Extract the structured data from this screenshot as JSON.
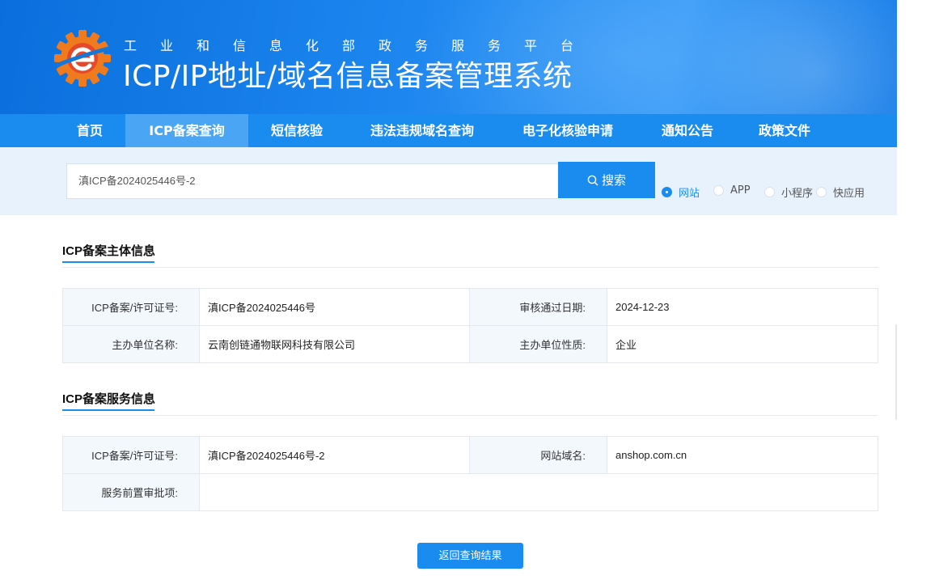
{
  "header": {
    "subtitle": "工业和信息化部政务服务平台",
    "title": "ICP/IP地址/域名信息备案管理系统",
    "logo_icon": "e-gear-logo-icon"
  },
  "nav": {
    "items": [
      {
        "label": "首页",
        "active": false
      },
      {
        "label": "ICP备案查询",
        "active": true
      },
      {
        "label": "短信核验",
        "active": false
      },
      {
        "label": "违法违规域名查询",
        "active": false
      },
      {
        "label": "电子化核验申请",
        "active": false
      },
      {
        "label": "通知公告",
        "active": false
      },
      {
        "label": "政策文件",
        "active": false
      }
    ]
  },
  "search": {
    "value": "滇ICP备2024025446号-2",
    "button_label": "搜索",
    "button_icon": "search-icon",
    "options": [
      {
        "label": "网站",
        "checked": true
      },
      {
        "label": "APP",
        "checked": false
      },
      {
        "label": "小程序",
        "checked": false
      },
      {
        "label": "快应用",
        "checked": false
      }
    ]
  },
  "subject_section": {
    "title": "ICP备案主体信息",
    "rows": [
      {
        "k1": "ICP备案/许可证号:",
        "v1": "滇ICP备2024025446号",
        "k2": "审核通过日期:",
        "v2": "2024-12-23"
      },
      {
        "k1": "主办单位名称:",
        "v1": "云南创链通物联网科技有限公司",
        "k2": "主办单位性质:",
        "v2": "企业"
      }
    ]
  },
  "service_section": {
    "title": "ICP备案服务信息",
    "rows": [
      {
        "k1": "ICP备案/许可证号:",
        "v1": "滇ICP备2024025446号-2",
        "k2": "网站域名:",
        "v2": "anshop.com.cn"
      },
      {
        "k1": "服务前置审批项:",
        "v1": ""
      }
    ]
  },
  "back_button_label": "返回查询结果",
  "colors": {
    "primary": "#1a8cf0",
    "nav_active": "#4aa6f5",
    "band": "#e8f2fd",
    "key_cell": "#f3f8fd"
  }
}
